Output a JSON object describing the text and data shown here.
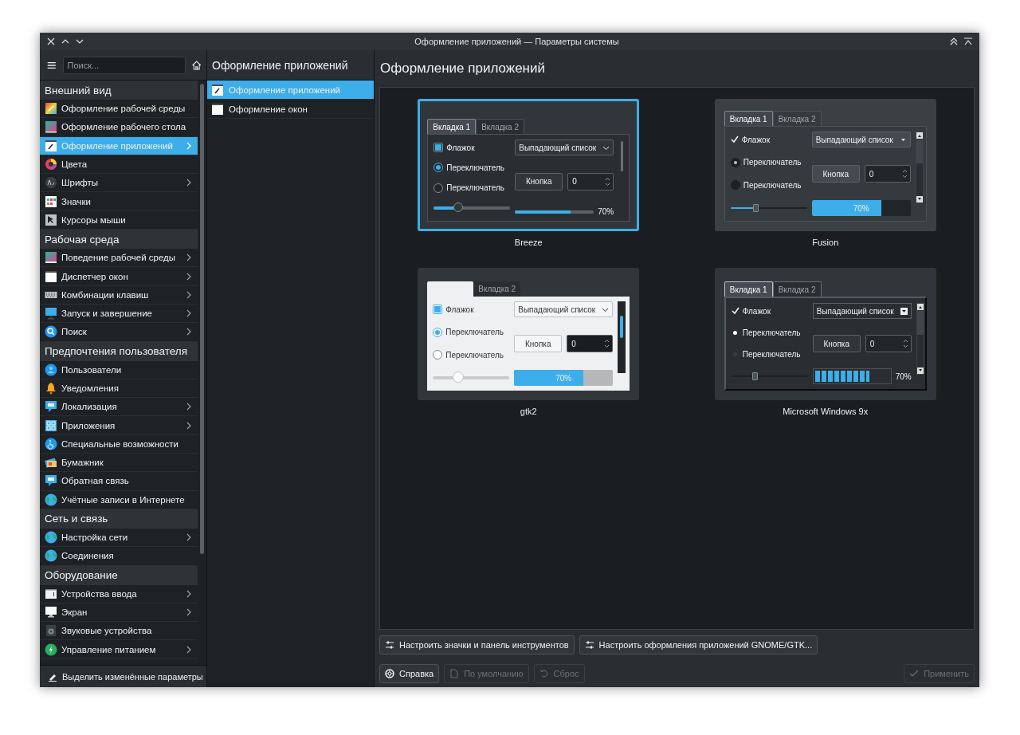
{
  "window": {
    "title": "Оформление приложений — Параметры системы"
  },
  "sidebar": {
    "search_placeholder": "Поиск...",
    "sections": [
      {
        "title": "Внешний вид",
        "items": [
          {
            "label": "Оформление рабочей среды",
            "expandable": false,
            "selected": false
          },
          {
            "label": "Оформление рабочего стола",
            "expandable": false,
            "selected": false
          },
          {
            "label": "Оформление приложений",
            "expandable": true,
            "selected": true
          },
          {
            "label": "Цвета",
            "expandable": false,
            "selected": false
          },
          {
            "label": "Шрифты",
            "expandable": true,
            "selected": false
          },
          {
            "label": "Значки",
            "expandable": false,
            "selected": false
          },
          {
            "label": "Курсоры мыши",
            "expandable": false,
            "selected": false
          }
        ]
      },
      {
        "title": "Рабочая среда",
        "items": [
          {
            "label": "Поведение рабочей среды",
            "expandable": true,
            "selected": false
          },
          {
            "label": "Диспетчер окон",
            "expandable": true,
            "selected": false
          },
          {
            "label": "Комбинации клавиш",
            "expandable": true,
            "selected": false
          },
          {
            "label": "Запуск и завершение",
            "expandable": true,
            "selected": false
          },
          {
            "label": "Поиск",
            "expandable": true,
            "selected": false
          }
        ]
      },
      {
        "title": "Предпочтения пользователя",
        "items": [
          {
            "label": "Пользователи",
            "expandable": false,
            "selected": false
          },
          {
            "label": "Уведомления",
            "expandable": false,
            "selected": false
          },
          {
            "label": "Локализация",
            "expandable": true,
            "selected": false
          },
          {
            "label": "Приложения",
            "expandable": true,
            "selected": false
          },
          {
            "label": "Специальные возможности",
            "expandable": false,
            "selected": false
          },
          {
            "label": "Бумажник",
            "expandable": false,
            "selected": false
          },
          {
            "label": "Обратная связь",
            "expandable": false,
            "selected": false
          },
          {
            "label": "Учётные записи в Интернете",
            "expandable": false,
            "selected": false
          }
        ]
      },
      {
        "title": "Сеть и связь",
        "items": [
          {
            "label": "Настройка сети",
            "expandable": true,
            "selected": false
          },
          {
            "label": "Соединения",
            "expandable": false,
            "selected": false
          }
        ]
      },
      {
        "title": "Оборудование",
        "items": [
          {
            "label": "Устройства ввода",
            "expandable": true,
            "selected": false
          },
          {
            "label": "Экран",
            "expandable": true,
            "selected": false
          },
          {
            "label": "Звуковые устройства",
            "expandable": false,
            "selected": false
          },
          {
            "label": "Управление питанием",
            "expandable": true,
            "selected": false
          }
        ]
      }
    ],
    "footer": "Выделить изменённые параметры"
  },
  "subpages": {
    "title": "Оформление приложений",
    "items": [
      {
        "label": "Оформление приложений",
        "selected": true
      },
      {
        "label": "Оформление окон",
        "selected": false
      }
    ]
  },
  "page": {
    "title": "Оформление приложений",
    "styles": [
      {
        "name": "Breeze",
        "kind": "breeze",
        "selected": true,
        "tabs": [
          {
            "label": "Вкладка 1",
            "selected": true
          },
          {
            "label": "Вкладка 2",
            "selected": false
          }
        ],
        "checkbox": {
          "label": "Флажок",
          "checked": true
        },
        "radios": [
          {
            "label": "Переключатель",
            "selected": true
          },
          {
            "label": "Переключатель",
            "selected": false
          }
        ],
        "combo": "Выпадающий список",
        "button": "Кнопка",
        "spin": "0",
        "slider": {
          "level": 0.32
        },
        "progress": {
          "level": 0.7,
          "text": "70%"
        }
      },
      {
        "name": "Fusion",
        "kind": "fusion",
        "selected": false,
        "tabs": [
          {
            "label": "Вкладка 1",
            "selected": true
          },
          {
            "label": "Вкладка 2",
            "selected": false
          }
        ],
        "checkbox": {
          "label": "Флажок",
          "checked": true
        },
        "radios": [
          {
            "label": "Переключатель",
            "selected": true
          },
          {
            "label": "Переключатель",
            "selected": false
          }
        ],
        "combo": "Выпадающий список",
        "button": "Кнопка",
        "spin": "0",
        "slider": {
          "level": 0.33
        },
        "progress": {
          "level": 0.7,
          "text": "70%"
        }
      },
      {
        "name": "gtk2",
        "kind": "gtk2",
        "selected": false,
        "tabs": [
          {
            "selected": true
          },
          {
            "label": "Вкладка 2",
            "selected": false
          }
        ],
        "checkbox": {
          "label": "Флажок",
          "checked": true
        },
        "radios": [
          {
            "label": "Переключатель",
            "selected": true
          },
          {
            "label": "Переключатель",
            "selected": false
          }
        ],
        "combo": "Выпадающий список",
        "button": "Кнопка",
        "spin": "0",
        "slider": {
          "level": 0.33
        },
        "progress": {
          "level": 0.7,
          "text": "70%"
        }
      },
      {
        "name": "Microsoft Windows 9x",
        "kind": "win9x",
        "selected": false,
        "tabs": [
          {
            "label": "Вкладка 1",
            "selected": true
          },
          {
            "label": "Вкладка 2",
            "selected": false
          }
        ],
        "checkbox": {
          "label": "Флажок",
          "checked": true
        },
        "radios": [
          {
            "label": "Переключатель",
            "selected": true
          },
          {
            "label": "Переключатель",
            "selected": false
          }
        ],
        "combo": "Выпадающий список",
        "button": "Кнопка",
        "spin": "0",
        "slider": {
          "level": 0.3
        },
        "progress": {
          "level": 0.7,
          "text": "70%"
        }
      }
    ],
    "tool_buttons": [
      "Настроить значки и панель инструментов",
      "Настроить оформления приложений GNOME/GTK..."
    ],
    "footer_buttons": [
      {
        "label": "Справка",
        "kind": "help",
        "disabled": false
      },
      {
        "label": "По умолчанию",
        "kind": "defaults",
        "disabled": true
      },
      {
        "label": "Сброс",
        "kind": "reset",
        "disabled": true
      },
      {
        "label": "Применить",
        "kind": "apply",
        "disabled": true
      }
    ]
  }
}
